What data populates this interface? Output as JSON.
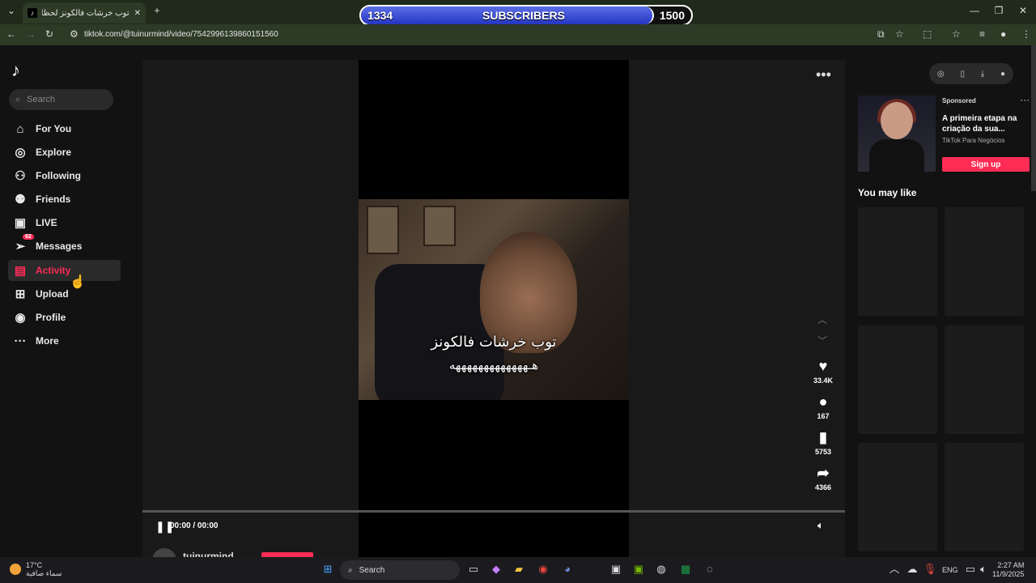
{
  "browser": {
    "tab_title": "توب خرشات فالكونز لحظات مـ...",
    "url": "tiktok.com/@tuinurmind/video/7542996139860151560",
    "subscribers": {
      "current": "1334",
      "label": "SUBSCRIBERS",
      "goal": "1500",
      "progress_fraction": 0.888
    }
  },
  "sidebar": {
    "logo_icon": "tiktok-logo-icon",
    "search_placeholder": "Search",
    "items": [
      {
        "label": "For You",
        "icon": "home-icon"
      },
      {
        "label": "Explore",
        "icon": "compass-icon"
      },
      {
        "label": "Following",
        "icon": "user-plus-icon"
      },
      {
        "label": "Friends",
        "icon": "friends-icon"
      },
      {
        "label": "LIVE",
        "icon": "live-icon"
      },
      {
        "label": "Messages",
        "icon": "send-icon",
        "badge": "62"
      },
      {
        "label": "Activity",
        "icon": "activity-icon"
      },
      {
        "label": "Upload",
        "icon": "plus-square-icon"
      },
      {
        "label": "Profile",
        "icon": "avatar-icon"
      },
      {
        "label": "More",
        "icon": "more-icon"
      }
    ]
  },
  "video": {
    "caption_line1": "توب خرشات فالكونز",
    "caption_line2": "هـهههههههههههههه",
    "time": "00:00 / 00:00",
    "likes": "33.4K",
    "comments": "167",
    "saves": "5753",
    "shares": "4366",
    "author": "tuinurmind",
    "progress_fraction": 0
  },
  "right_panel": {
    "sponsored_label": "Sponsored",
    "ad_title": "A primeira etapa na criação da sua...",
    "ad_brand": "TikTok Para Negócios",
    "signup_label": "Sign up",
    "you_may_like": "You may like"
  },
  "taskbar": {
    "temperature": "17°C",
    "weather_desc": "سماء صافية",
    "search_label": "Search",
    "lang": "ENG",
    "time": "2:27 AM",
    "date": "11/9/2025"
  },
  "colors": {
    "accent": "#fe2c55",
    "chrome": "#2c3a26",
    "page_bg": "#121212"
  }
}
